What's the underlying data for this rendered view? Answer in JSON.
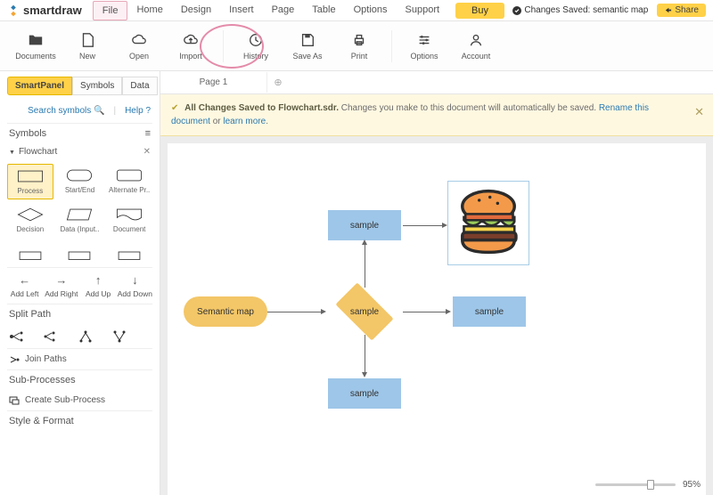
{
  "brand": "smartdraw",
  "menu": [
    "File",
    "Home",
    "Design",
    "Insert",
    "Page",
    "Table",
    "Options",
    "Support"
  ],
  "menu_highlight_index": 0,
  "buy_label": "Buy",
  "save_status": "Changes Saved: semantic map",
  "share_label": "Share",
  "ribbon": [
    {
      "label": "Documents",
      "icon": "folder"
    },
    {
      "label": "New",
      "icon": "file"
    },
    {
      "label": "Open",
      "icon": "cloud"
    },
    {
      "label": "Import",
      "icon": "cloud-up"
    },
    {
      "sep": true
    },
    {
      "label": "History",
      "icon": "history"
    },
    {
      "label": "Save As",
      "icon": "save"
    },
    {
      "label": "Print",
      "icon": "print"
    },
    {
      "sep": true
    },
    {
      "label": "Options",
      "icon": "sliders"
    },
    {
      "label": "Account",
      "icon": "user"
    }
  ],
  "panel_tabs": [
    "SmartPanel",
    "Symbols",
    "Data"
  ],
  "panel_active_index": 0,
  "search_label": "Search symbols",
  "help_label": "Help",
  "symbols_head": "Symbols",
  "symbol_category": "Flowchart",
  "symbols": [
    "Process",
    "Start/End",
    "Alternate Pr..",
    "Decision",
    "Data (Input..",
    "Document"
  ],
  "symbol_selected_index": 0,
  "add_actions": [
    "Add Left",
    "Add Right",
    "Add Up",
    "Add Down"
  ],
  "split_head": "Split Path",
  "join_label": "Join Paths",
  "subproc_head": "Sub-Processes",
  "create_sub": "Create Sub-Process",
  "style_head": "Style & Format",
  "page_tab": "Page 1",
  "notice_bold": "All Changes Saved to Flowchart.sdr.",
  "notice_text": " Changes you make to this document will automatically be saved. ",
  "notice_link1": "Rename this document",
  "notice_or": " or ",
  "notice_link2": "learn more",
  "notice_period": ".",
  "nodes": {
    "semantic": "Semantic map",
    "top": "sample",
    "center": "sample",
    "right": "sample",
    "bottom": "sample"
  },
  "zoom": "95%"
}
